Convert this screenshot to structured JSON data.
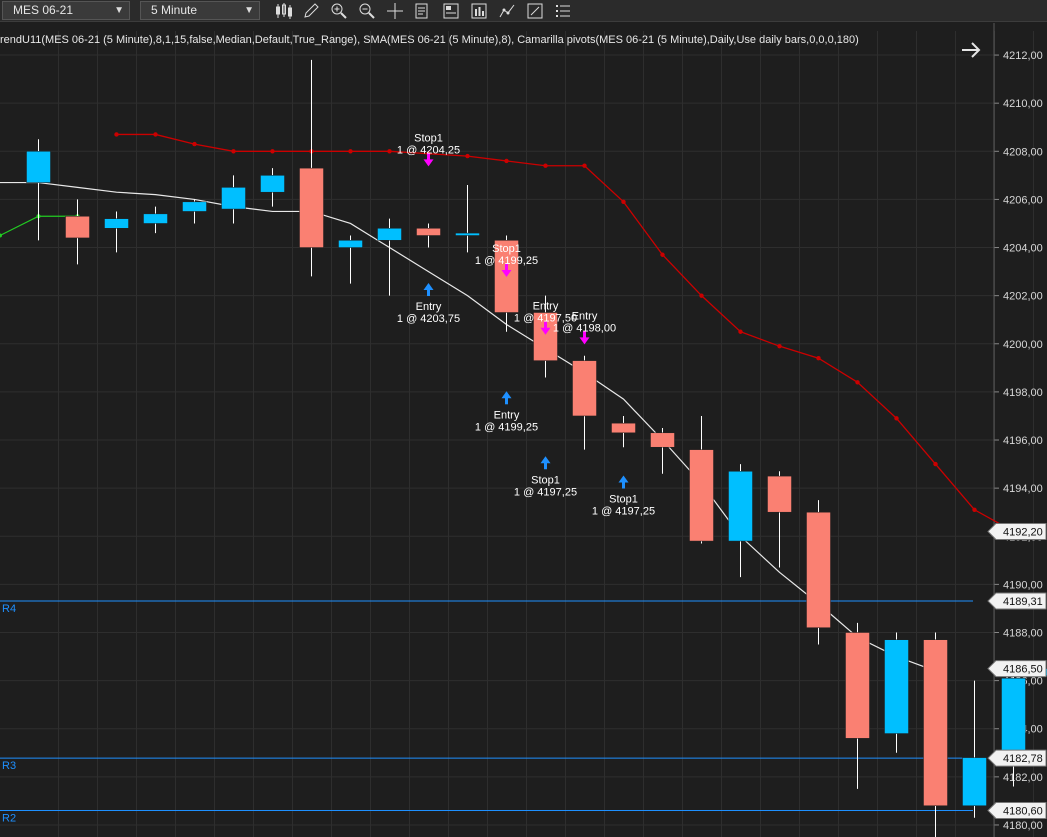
{
  "toolbar": {
    "instrument": "MES 06-21",
    "timeframe": "5 Minute",
    "icons": [
      "candlestick-icon",
      "pencil-icon",
      "zoom-in-icon",
      "zoom-out-icon",
      "crosshair-icon",
      "data-box-icon",
      "properties-icon",
      "strategy-icon",
      "indicators-icon",
      "drawing-tools-icon",
      "order-list-icon"
    ]
  },
  "indicator_text": "rendU11(MES 06-21 (5 Minute),8,1,15,false,Median,Default,True_Range), SMA(MES 06-21 (5 Minute),8), Camarilla pivots(MES 06-21 (5 Minute),Daily,Use daily bars,0,0,0,180)",
  "chart_data": {
    "type": "candlestick",
    "ylim": [
      4179.5,
      4213.0
    ],
    "y_ticks": [
      "4180,00",
      "4182,00",
      "4184,00",
      "4186,00",
      "4188,00",
      "4190,00",
      "4192,00",
      "4194,00",
      "4196,00",
      "4198,00",
      "4200,00",
      "4202,00",
      "4204,00",
      "4206,00",
      "4208,00",
      "4210,00",
      "4212,00"
    ],
    "y_tick_values": [
      4180,
      4182,
      4184,
      4186,
      4188,
      4190,
      4192,
      4194,
      4196,
      4198,
      4200,
      4202,
      4204,
      4206,
      4208,
      4210,
      4212
    ],
    "colors": {
      "up": "#00bfff",
      "down": "#fa8072",
      "wick": "#ffffff",
      "camarilla": "#cc0000",
      "sma": "#e8e8e8",
      "trend": "#22cc22",
      "pivot": "#1e90ff",
      "grid": "#2e2e2e",
      "entry_arrow": "#1e90ff",
      "stop_arrow": "#ff00ff"
    },
    "candles": [
      {
        "o": 4206.7,
        "h": 4208.5,
        "l": 4204.3,
        "c": 4208.0
      },
      {
        "o": 4205.3,
        "h": 4206.0,
        "l": 4203.3,
        "c": 4204.4
      },
      {
        "o": 4204.8,
        "h": 4205.5,
        "l": 4203.8,
        "c": 4205.2
      },
      {
        "o": 4205.0,
        "h": 4205.7,
        "l": 4204.6,
        "c": 4205.4
      },
      {
        "o": 4205.5,
        "h": 4206.0,
        "l": 4205.0,
        "c": 4205.9
      },
      {
        "o": 4205.6,
        "h": 4207.0,
        "l": 4205.0,
        "c": 4206.5
      },
      {
        "o": 4206.3,
        "h": 4207.3,
        "l": 4205.7,
        "c": 4207.0
      },
      {
        "o": 4207.3,
        "h": 4211.8,
        "l": 4202.8,
        "c": 4204.0
      },
      {
        "o": 4204.0,
        "h": 4204.5,
        "l": 4202.5,
        "c": 4204.3
      },
      {
        "o": 4204.3,
        "h": 4205.2,
        "l": 4202.0,
        "c": 4204.8
      },
      {
        "o": 4204.8,
        "h": 4205.0,
        "l": 4204.0,
        "c": 4204.5
      },
      {
        "o": 4204.5,
        "h": 4206.6,
        "l": 4203.8,
        "c": 4204.6
      },
      {
        "o": 4204.3,
        "h": 4204.5,
        "l": 4200.5,
        "c": 4201.3
      },
      {
        "o": 4201.3,
        "h": 4202.0,
        "l": 4198.6,
        "c": 4199.3
      },
      {
        "o": 4199.3,
        "h": 4199.5,
        "l": 4195.6,
        "c": 4197.0
      },
      {
        "o": 4196.7,
        "h": 4197.0,
        "l": 4195.7,
        "c": 4196.3
      },
      {
        "o": 4196.3,
        "h": 4196.5,
        "l": 4194.6,
        "c": 4195.7
      },
      {
        "o": 4195.6,
        "h": 4197.0,
        "l": 4191.7,
        "c": 4191.8
      },
      {
        "o": 4191.8,
        "h": 4195.0,
        "l": 4190.3,
        "c": 4194.7
      },
      {
        "o": 4194.5,
        "h": 4194.7,
        "l": 4190.7,
        "c": 4193.0
      },
      {
        "o": 4193.0,
        "h": 4193.5,
        "l": 4187.5,
        "c": 4188.2
      },
      {
        "o": 4188.0,
        "h": 4188.4,
        "l": 4181.5,
        "c": 4183.6
      },
      {
        "o": 4183.8,
        "h": 4188.0,
        "l": 4183.0,
        "c": 4187.7
      },
      {
        "o": 4187.7,
        "h": 4188.0,
        "l": 4178.0,
        "c": 4180.8
      },
      {
        "o": 4180.8,
        "h": 4186.0,
        "l": 4180.3,
        "c": 4182.8
      },
      {
        "o": 4182.7,
        "h": 4186.7,
        "l": 4181.6,
        "c": 4186.1
      },
      {
        "o": 4186.2,
        "h": 4187.1,
        "l": 4184.1,
        "c": 4186.5
      }
    ],
    "camarilla": [
      4208.7,
      4208.7,
      4208.3,
      4208.0,
      4208.0,
      4208.0,
      4208.0,
      4208.0,
      4207.9,
      4207.8,
      4207.6,
      4207.4,
      4207.4,
      4205.9,
      4203.7,
      4202.0,
      4200.5,
      4199.9,
      4199.4,
      4198.4,
      4196.9,
      4195.0,
      4193.1,
      4192.2
    ],
    "camarilla_x_start": 3,
    "sma": [
      4206.7,
      4206.7,
      4206.5,
      4206.3,
      4206.2,
      4206.0,
      4205.7,
      4205.5,
      4205.5,
      4205.0,
      4204.0,
      4203.0,
      4202.0,
      4200.8,
      4199.8,
      4198.8,
      4197.7,
      4196.0,
      4194.2,
      4192.0,
      4190.5,
      4189.2,
      4187.8,
      4187.0,
      4186.4
    ],
    "sma_x_start": 0,
    "trend": [
      {
        "x": 0,
        "y": 4204.5
      },
      {
        "x": 1,
        "y": 4205.3
      },
      {
        "x": 2,
        "y": 4205.3
      }
    ],
    "pivots": [
      {
        "name": "R4",
        "value": 4189.31,
        "label": "4189,31"
      },
      {
        "name": "R3",
        "value": 4182.78,
        "label": "4182,78"
      },
      {
        "name": "R2",
        "value": 4180.6,
        "label": "4180,60"
      }
    ],
    "price_flags": [
      {
        "value": 4192.2,
        "label": "4192,20"
      },
      {
        "value": 4186.5,
        "label": "4186,50"
      }
    ],
    "trades": [
      {
        "bar": 10,
        "kind": "stop",
        "dir": "down",
        "y": 4207.5,
        "label": [
          "Stop1",
          "1 @ 4204,25"
        ]
      },
      {
        "bar": 10,
        "kind": "entry",
        "dir": "up",
        "y": 4202.4,
        "label": [
          "Entry",
          "1 @ 4203,75"
        ]
      },
      {
        "bar": 12,
        "kind": "stop",
        "dir": "down",
        "y": 4202.9,
        "label": [
          "Stop1",
          "1 @ 4199,25"
        ]
      },
      {
        "bar": 12,
        "kind": "entry",
        "dir": "up",
        "y": 4197.9,
        "label": [
          "Entry",
          "1 @ 4199,25"
        ]
      },
      {
        "bar": 13,
        "kind": "stop",
        "dir": "down",
        "y": 4200.5,
        "label": [
          "Entry",
          "1 @ 4197,50"
        ]
      },
      {
        "bar": 13,
        "kind": "entry",
        "dir": "up",
        "y": 4195.2,
        "label": [
          "Stop1",
          "1 @ 4197,25"
        ]
      },
      {
        "bar": 14,
        "kind": "stop",
        "dir": "down",
        "y": 4200.1,
        "label": [
          "Entry",
          "1 @ 4198,00"
        ]
      },
      {
        "bar": 15,
        "kind": "entry",
        "dir": "up",
        "y": 4194.4,
        "label": [
          "Stop1",
          "1 @ 4197,25"
        ]
      }
    ]
  }
}
